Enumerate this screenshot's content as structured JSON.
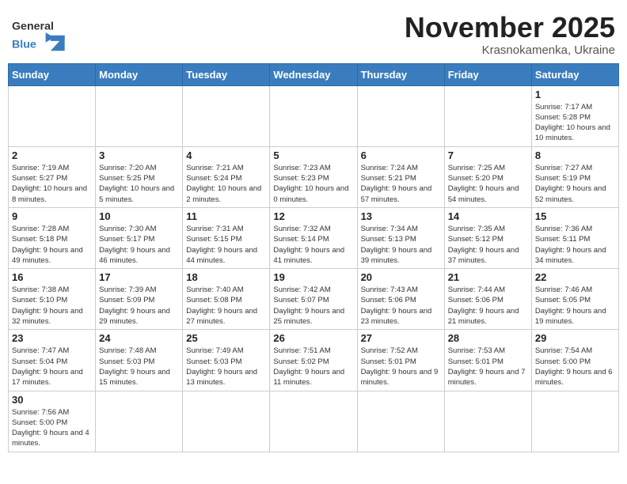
{
  "header": {
    "logo_general": "General",
    "logo_blue": "Blue",
    "month": "November 2025",
    "location": "Krasnokamenka, Ukraine"
  },
  "weekdays": [
    "Sunday",
    "Monday",
    "Tuesday",
    "Wednesday",
    "Thursday",
    "Friday",
    "Saturday"
  ],
  "weeks": [
    [
      {
        "day": "",
        "info": ""
      },
      {
        "day": "",
        "info": ""
      },
      {
        "day": "",
        "info": ""
      },
      {
        "day": "",
        "info": ""
      },
      {
        "day": "",
        "info": ""
      },
      {
        "day": "",
        "info": ""
      },
      {
        "day": "1",
        "info": "Sunrise: 7:17 AM\nSunset: 5:28 PM\nDaylight: 10 hours and 10 minutes."
      }
    ],
    [
      {
        "day": "2",
        "info": "Sunrise: 7:19 AM\nSunset: 5:27 PM\nDaylight: 10 hours and 8 minutes."
      },
      {
        "day": "3",
        "info": "Sunrise: 7:20 AM\nSunset: 5:25 PM\nDaylight: 10 hours and 5 minutes."
      },
      {
        "day": "4",
        "info": "Sunrise: 7:21 AM\nSunset: 5:24 PM\nDaylight: 10 hours and 2 minutes."
      },
      {
        "day": "5",
        "info": "Sunrise: 7:23 AM\nSunset: 5:23 PM\nDaylight: 10 hours and 0 minutes."
      },
      {
        "day": "6",
        "info": "Sunrise: 7:24 AM\nSunset: 5:21 PM\nDaylight: 9 hours and 57 minutes."
      },
      {
        "day": "7",
        "info": "Sunrise: 7:25 AM\nSunset: 5:20 PM\nDaylight: 9 hours and 54 minutes."
      },
      {
        "day": "8",
        "info": "Sunrise: 7:27 AM\nSunset: 5:19 PM\nDaylight: 9 hours and 52 minutes."
      }
    ],
    [
      {
        "day": "9",
        "info": "Sunrise: 7:28 AM\nSunset: 5:18 PM\nDaylight: 9 hours and 49 minutes."
      },
      {
        "day": "10",
        "info": "Sunrise: 7:30 AM\nSunset: 5:17 PM\nDaylight: 9 hours and 46 minutes."
      },
      {
        "day": "11",
        "info": "Sunrise: 7:31 AM\nSunset: 5:15 PM\nDaylight: 9 hours and 44 minutes."
      },
      {
        "day": "12",
        "info": "Sunrise: 7:32 AM\nSunset: 5:14 PM\nDaylight: 9 hours and 41 minutes."
      },
      {
        "day": "13",
        "info": "Sunrise: 7:34 AM\nSunset: 5:13 PM\nDaylight: 9 hours and 39 minutes."
      },
      {
        "day": "14",
        "info": "Sunrise: 7:35 AM\nSunset: 5:12 PM\nDaylight: 9 hours and 37 minutes."
      },
      {
        "day": "15",
        "info": "Sunrise: 7:36 AM\nSunset: 5:11 PM\nDaylight: 9 hours and 34 minutes."
      }
    ],
    [
      {
        "day": "16",
        "info": "Sunrise: 7:38 AM\nSunset: 5:10 PM\nDaylight: 9 hours and 32 minutes."
      },
      {
        "day": "17",
        "info": "Sunrise: 7:39 AM\nSunset: 5:09 PM\nDaylight: 9 hours and 29 minutes."
      },
      {
        "day": "18",
        "info": "Sunrise: 7:40 AM\nSunset: 5:08 PM\nDaylight: 9 hours and 27 minutes."
      },
      {
        "day": "19",
        "info": "Sunrise: 7:42 AM\nSunset: 5:07 PM\nDaylight: 9 hours and 25 minutes."
      },
      {
        "day": "20",
        "info": "Sunrise: 7:43 AM\nSunset: 5:06 PM\nDaylight: 9 hours and 23 minutes."
      },
      {
        "day": "21",
        "info": "Sunrise: 7:44 AM\nSunset: 5:06 PM\nDaylight: 9 hours and 21 minutes."
      },
      {
        "day": "22",
        "info": "Sunrise: 7:46 AM\nSunset: 5:05 PM\nDaylight: 9 hours and 19 minutes."
      }
    ],
    [
      {
        "day": "23",
        "info": "Sunrise: 7:47 AM\nSunset: 5:04 PM\nDaylight: 9 hours and 17 minutes."
      },
      {
        "day": "24",
        "info": "Sunrise: 7:48 AM\nSunset: 5:03 PM\nDaylight: 9 hours and 15 minutes."
      },
      {
        "day": "25",
        "info": "Sunrise: 7:49 AM\nSunset: 5:03 PM\nDaylight: 9 hours and 13 minutes."
      },
      {
        "day": "26",
        "info": "Sunrise: 7:51 AM\nSunset: 5:02 PM\nDaylight: 9 hours and 11 minutes."
      },
      {
        "day": "27",
        "info": "Sunrise: 7:52 AM\nSunset: 5:01 PM\nDaylight: 9 hours and 9 minutes."
      },
      {
        "day": "28",
        "info": "Sunrise: 7:53 AM\nSunset: 5:01 PM\nDaylight: 9 hours and 7 minutes."
      },
      {
        "day": "29",
        "info": "Sunrise: 7:54 AM\nSunset: 5:00 PM\nDaylight: 9 hours and 6 minutes."
      }
    ],
    [
      {
        "day": "30",
        "info": "Sunrise: 7:56 AM\nSunset: 5:00 PM\nDaylight: 9 hours and 4 minutes."
      },
      {
        "day": "",
        "info": ""
      },
      {
        "day": "",
        "info": ""
      },
      {
        "day": "",
        "info": ""
      },
      {
        "day": "",
        "info": ""
      },
      {
        "day": "",
        "info": ""
      },
      {
        "day": "",
        "info": ""
      }
    ]
  ]
}
